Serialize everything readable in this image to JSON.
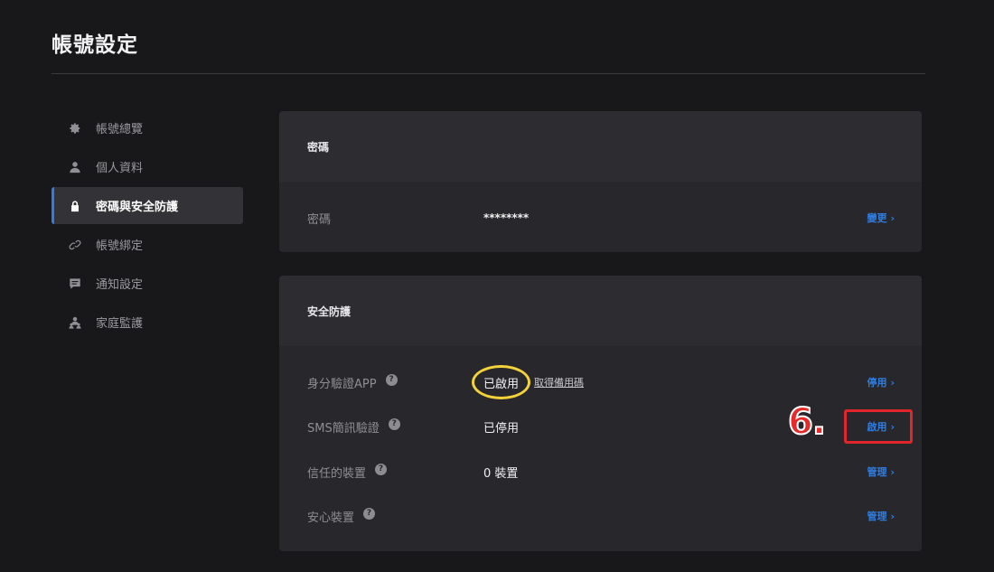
{
  "page": {
    "title": "帳號設定"
  },
  "sidebar": {
    "items": [
      {
        "label": "帳號總覽",
        "icon": "gear-icon"
      },
      {
        "label": "個人資料",
        "icon": "user-icon"
      },
      {
        "label": "密碼與安全防護",
        "icon": "lock-icon",
        "active": true
      },
      {
        "label": "帳號綁定",
        "icon": "link-icon"
      },
      {
        "label": "通知設定",
        "icon": "message-icon"
      },
      {
        "label": "家庭監護",
        "icon": "family-icon"
      }
    ]
  },
  "password_card": {
    "header": "密碼",
    "label": "密碼",
    "value": "********",
    "action": "變更"
  },
  "security_card": {
    "header": "安全防護",
    "rows": [
      {
        "label": "身分驗證APP",
        "value": "已啟用",
        "link": "取得備用碼",
        "action": "停用"
      },
      {
        "label": "SMS簡訊驗證",
        "value": "已停用",
        "action": "啟用"
      },
      {
        "label": "信任的裝置",
        "value": "0 裝置",
        "action": "管理"
      },
      {
        "label": "安心裝置",
        "value": "",
        "action": "管理"
      }
    ]
  },
  "annotation": {
    "step": "6."
  },
  "colors": {
    "accent": "#2f7de1",
    "highlight_circle": "#f4d23a",
    "highlight_box": "#e0262c"
  }
}
